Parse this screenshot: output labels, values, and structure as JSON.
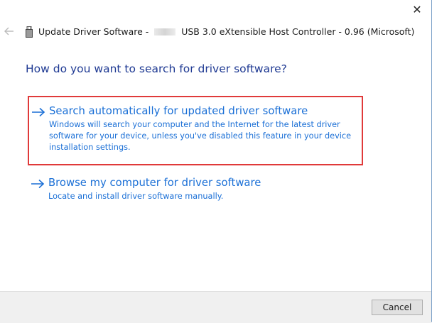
{
  "window": {
    "close_glyph": "✕",
    "title_prefix": "Update Driver Software - ",
    "title_suffix": " USB 3.0 eXtensible Host Controller - 0.96 (Microsoft)"
  },
  "page": {
    "question": "How do you want to search for driver software?"
  },
  "options": [
    {
      "title": "Search automatically for updated driver software",
      "description": "Windows will search your computer and the Internet for the latest driver software for your device, unless you've disabled this feature in your device installation settings."
    },
    {
      "title": "Browse my computer for driver software",
      "description": "Locate and install driver software manually."
    }
  ],
  "footer": {
    "cancel_label": "Cancel"
  },
  "icons": {
    "back": "back-arrow-icon",
    "device": "usb-device-icon",
    "option_arrow": "right-arrow-icon",
    "close": "close-icon"
  },
  "colors": {
    "link": "#1a6fd6",
    "heading": "#1f3a93",
    "highlight": "#e03a3a",
    "footer_bg": "#f0f0f0"
  }
}
